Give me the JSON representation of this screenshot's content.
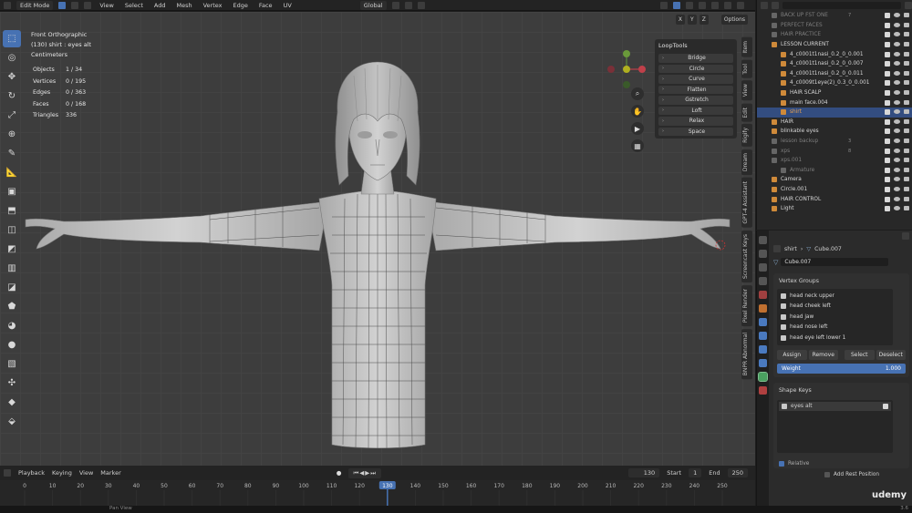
{
  "topbar": {
    "mode": "Edit Mode",
    "menus": [
      "View",
      "Select",
      "Add",
      "Mesh",
      "Vertex",
      "Edge",
      "Face",
      "UV"
    ],
    "transform_orientation": "Global"
  },
  "viewport": {
    "view_name": "Front Orthographic",
    "object_label": "(130) shirt : eyes alt",
    "units": "Centimeters",
    "axis_x": "X",
    "axis_y": "Y",
    "axis_z": "Z",
    "options_label": "Options",
    "stats": [
      {
        "label": "Objects",
        "value": "1 / 34"
      },
      {
        "label": "Vertices",
        "value": "0 / 195"
      },
      {
        "label": "Edges",
        "value": "0 / 363"
      },
      {
        "label": "Faces",
        "value": "0 / 168"
      },
      {
        "label": "Triangles",
        "value": "336"
      }
    ]
  },
  "looptools": {
    "title": "LoopTools",
    "items": [
      "Bridge",
      "Circle",
      "Curve",
      "Flatten",
      "Gstretch",
      "Loft",
      "Relax",
      "Space"
    ]
  },
  "side_tabs": [
    "Item",
    "Tool",
    "View",
    "Edit",
    "Rigify",
    "Dream",
    "GPT-4 Assistant",
    "Screencast Keys",
    "Pixel Render",
    "BNPR Abnormal"
  ],
  "timeline": {
    "menus": [
      "Playback",
      "Keying",
      "View",
      "Marker"
    ],
    "current_frame": "130",
    "start_label": "Start",
    "start": "1",
    "end_label": "End",
    "end": "250",
    "ticks": [
      "0",
      "10",
      "20",
      "30",
      "40",
      "50",
      "60",
      "70",
      "80",
      "90",
      "100",
      "110",
      "120",
      "130",
      "140",
      "150",
      "160",
      "170",
      "180",
      "190",
      "200",
      "210",
      "220",
      "230",
      "240",
      "250"
    ],
    "playhead_frame": "130"
  },
  "status": {
    "pan_view": "Pan View",
    "version": "3.6"
  },
  "outliner": {
    "rows": [
      {
        "name": "BACK UP FST ONE",
        "tag": "7",
        "dim": true
      },
      {
        "name": "PERFECT FACES",
        "tag": "",
        "dim": true
      },
      {
        "name": "HAIR PRACTICE",
        "tag": "",
        "dim": true
      },
      {
        "name": "LESSON CURRENT",
        "tag": "",
        "dim": false
      },
      {
        "name": "4_c0001t1nasi_0.2_0_0.001",
        "tag": "",
        "dim": false
      },
      {
        "name": "4_c0001t1nasi_0.2_0_0.007",
        "tag": "",
        "dim": false
      },
      {
        "name": "4_c0001t1nasi_0.2_0_0.011",
        "tag": "",
        "dim": false
      },
      {
        "name": "4_c0009t1eye(2)_0.3_0_0.001",
        "tag": "",
        "dim": false
      },
      {
        "name": "HAIR SCALP",
        "tag": "",
        "dim": false
      },
      {
        "name": "main face.004",
        "tag": "",
        "dim": false
      },
      {
        "name": "shirt",
        "tag": "",
        "dim": false,
        "selected": true
      },
      {
        "name": "HAIR",
        "tag": "",
        "dim": false
      },
      {
        "name": "blinkable eyes",
        "tag": "",
        "dim": false
      },
      {
        "name": "lesson backup",
        "tag": "3",
        "dim": true
      },
      {
        "name": "xps",
        "tag": "8",
        "dim": true
      },
      {
        "name": "xps.001",
        "tag": "",
        "dim": true
      },
      {
        "name": "Armature",
        "tag": "",
        "dim": true
      },
      {
        "name": "Camera",
        "tag": "",
        "dim": false
      },
      {
        "name": "Circle.001",
        "tag": "",
        "dim": false
      },
      {
        "name": "HAIR CONTROL",
        "tag": "",
        "dim": false
      },
      {
        "name": "Light",
        "tag": "",
        "dim": false
      }
    ]
  },
  "properties": {
    "breadcrumb_object": "shirt",
    "breadcrumb_mesh": "Cube.007",
    "mesh_name": "Cube.007",
    "vertex_groups_title": "Vertex Groups",
    "vertex_groups": [
      "head neck upper",
      "head cheek left",
      "head jaw",
      "head nose left",
      "head eye left lower 1"
    ],
    "buttons": [
      "Assign",
      "Remove",
      "Select",
      "Deselect"
    ],
    "weight_label": "Weight",
    "weight_value": "1.000",
    "shape_keys_title": "Shape Keys",
    "shape_keys": [
      "eyes alt"
    ],
    "relative_label": "Relative",
    "add_rest_label": "Add Rest Position"
  },
  "watermark": "udemy",
  "colors": {
    "accent": "#4772b3",
    "viewport_bg": "#3d3d3d",
    "selected_row": "#334d80"
  }
}
